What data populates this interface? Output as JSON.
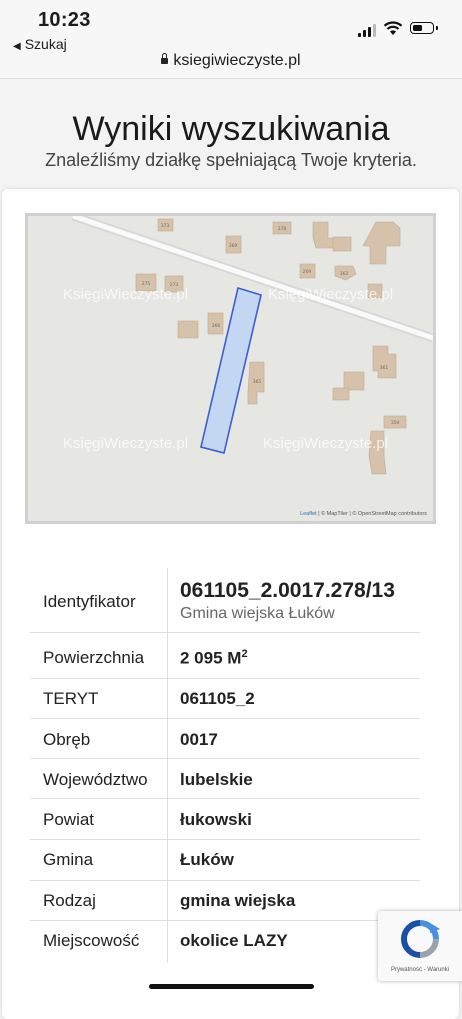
{
  "status": {
    "time": "10:23",
    "back_label": "Szukaj",
    "battery_level": 0.55
  },
  "browser": {
    "url": "ksiegiwieczyste.pl"
  },
  "header": {
    "title": "Wyniki wyszukiwania",
    "subtitle": "Znaleźliśmy działkę spełniającą Twoje kryteria."
  },
  "map": {
    "watermark": "KsięgiWieczyste.pl",
    "house_numbers": [
      "373",
      "369",
      "378",
      "269",
      "362",
      "275",
      "273",
      "366",
      "365",
      "361",
      "359"
    ],
    "attribution": {
      "leaflet": "Leaflet",
      "rest": " | © MapTiler | © OpenStreetMap contributors"
    },
    "parcel_color": "#c4d7f2",
    "parcel_stroke": "#3a5fd0"
  },
  "details": {
    "identyfikator": {
      "label": "Identyfikator",
      "value": "061105_2.0017.278/13",
      "sub": "Gmina wiejska Łuków"
    },
    "powierzchnia": {
      "label": "Powierzchnia",
      "value": "2 095 M",
      "unit_sup": "2"
    },
    "teryt": {
      "label": "TERYT",
      "value": "061105_2"
    },
    "obreb": {
      "label": "Obręb",
      "value": "0017"
    },
    "wojewodztwo": {
      "label": "Województwo",
      "value": "lubelskie"
    },
    "powiat": {
      "label": "Powiat",
      "value": "łukowski"
    },
    "gmina": {
      "label": "Gmina",
      "value": "Łuków"
    },
    "rodzaj": {
      "label": "Rodzaj",
      "value": "gmina wiejska"
    },
    "miejscowosc": {
      "label": "Miejscowość",
      "value": "okolice LAZY"
    }
  },
  "recaptcha": {
    "links": "Prywatność - Warunki"
  }
}
